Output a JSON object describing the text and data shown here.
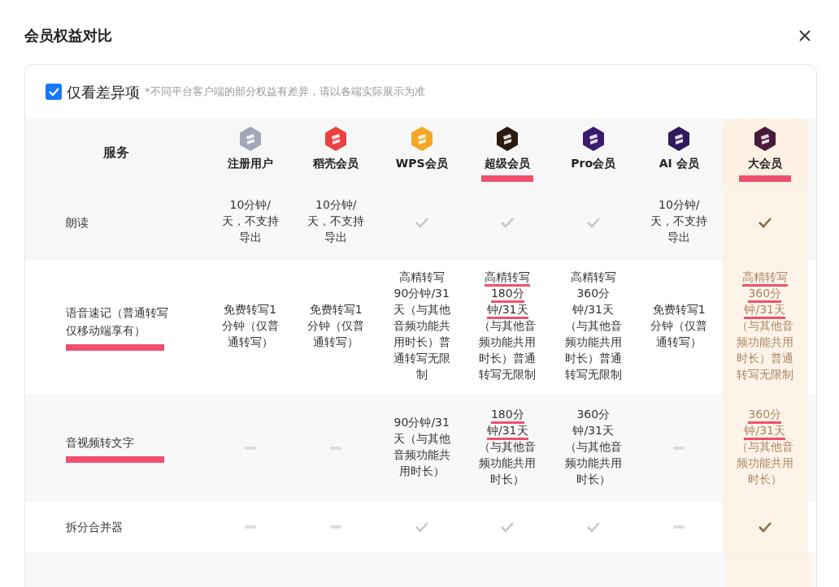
{
  "dialog": {
    "title": "会员权益对比"
  },
  "filter": {
    "label": "仅看差异项",
    "checked": true,
    "note": "*不同平台客户端的部分权益有差异，请以各端实际展示为准"
  },
  "table": {
    "service_heading": "服务",
    "columns": [
      {
        "label": "注册用户",
        "color": "#a3a7b8",
        "marked": false,
        "highlighted": false
      },
      {
        "label": "稻壳会员",
        "color": "#e8413f",
        "marked": false,
        "highlighted": false
      },
      {
        "label": "WPS会员",
        "color": "#f5a623",
        "marked": false,
        "highlighted": false
      },
      {
        "label": "超级会员",
        "color": "#2a1a10",
        "marked": true,
        "highlighted": false
      },
      {
        "label": "Pro会员",
        "color": "#3b1a6e",
        "marked": false,
        "highlighted": false
      },
      {
        "label": "AI 会员",
        "color": "#2e1a5c",
        "marked": false,
        "highlighted": false
      },
      {
        "label": "大会员",
        "color": "#4a1a3a",
        "marked": true,
        "highlighted": true
      }
    ],
    "rows": [
      {
        "label": "朗读",
        "marked": false,
        "cells": [
          {
            "kind": "text",
            "lines": [
              {
                "text": "10分钟/",
                "marked": false
              },
              {
                "text": "天，不支持",
                "marked": false
              },
              {
                "text": "导出",
                "marked": false
              }
            ]
          },
          {
            "kind": "text",
            "lines": [
              {
                "text": "10分钟/",
                "marked": false
              },
              {
                "text": "天，不支持",
                "marked": false
              },
              {
                "text": "导出",
                "marked": false
              }
            ]
          },
          {
            "kind": "check"
          },
          {
            "kind": "check"
          },
          {
            "kind": "check"
          },
          {
            "kind": "text",
            "lines": [
              {
                "text": "10分钟/",
                "marked": false
              },
              {
                "text": "天，不支持",
                "marked": false
              },
              {
                "text": "导出",
                "marked": false
              }
            ]
          },
          {
            "kind": "check"
          }
        ]
      },
      {
        "label": "语音速记（普通转写仅移动端享有）",
        "marked": true,
        "cells": [
          {
            "kind": "text",
            "lines": [
              {
                "text": "免费转写1",
                "marked": false
              },
              {
                "text": "分钟（仅普",
                "marked": false
              },
              {
                "text": "通转写）",
                "marked": false
              }
            ]
          },
          {
            "kind": "text",
            "lines": [
              {
                "text": "免费转写1",
                "marked": false
              },
              {
                "text": "分钟（仅普",
                "marked": false
              },
              {
                "text": "通转写）",
                "marked": false
              }
            ]
          },
          {
            "kind": "text",
            "lines": [
              {
                "text": "高精转写",
                "marked": false
              },
              {
                "text": "90分钟/31",
                "marked": false
              },
              {
                "text": "天（与其他",
                "marked": false
              },
              {
                "text": "音频功能共",
                "marked": false
              },
              {
                "text": "用时长）普",
                "marked": false
              },
              {
                "text": "通转写无限",
                "marked": false
              },
              {
                "text": "制",
                "marked": false
              }
            ]
          },
          {
            "kind": "text",
            "lines": [
              {
                "text": "高精转写",
                "marked": true
              },
              {
                "text": "180分",
                "marked": true
              },
              {
                "text": "钟/31天",
                "marked": true
              },
              {
                "text": "（与其他音",
                "marked": false
              },
              {
                "text": "频功能共用",
                "marked": false
              },
              {
                "text": "时长）普通",
                "marked": false
              },
              {
                "text": "转写无限制",
                "marked": false
              }
            ]
          },
          {
            "kind": "text",
            "lines": [
              {
                "text": "高精转写",
                "marked": false
              },
              {
                "text": "360分",
                "marked": false
              },
              {
                "text": "钟/31天",
                "marked": false
              },
              {
                "text": "（与其他音",
                "marked": false
              },
              {
                "text": "频功能共用",
                "marked": false
              },
              {
                "text": "时长）普通",
                "marked": false
              },
              {
                "text": "转写无限制",
                "marked": false
              }
            ]
          },
          {
            "kind": "text",
            "lines": [
              {
                "text": "免费转写1",
                "marked": false
              },
              {
                "text": "分钟（仅普",
                "marked": false
              },
              {
                "text": "通转写）",
                "marked": false
              }
            ]
          },
          {
            "kind": "text",
            "lines": [
              {
                "text": "高精转写",
                "marked": true
              },
              {
                "text": "360分",
                "marked": true
              },
              {
                "text": "钟/31天",
                "marked": true
              },
              {
                "text": "（与其他音",
                "marked": false
              },
              {
                "text": "频功能共用",
                "marked": false
              },
              {
                "text": "时长）普通",
                "marked": false
              },
              {
                "text": "转写无限制",
                "marked": false
              }
            ]
          }
        ]
      },
      {
        "label": "音视频转文字",
        "marked": true,
        "cells": [
          {
            "kind": "none"
          },
          {
            "kind": "none"
          },
          {
            "kind": "text",
            "lines": [
              {
                "text": "90分钟/31",
                "marked": false
              },
              {
                "text": "天（与其他",
                "marked": false
              },
              {
                "text": "音频功能共",
                "marked": false
              },
              {
                "text": "用时长）",
                "marked": false
              }
            ]
          },
          {
            "kind": "text",
            "lines": [
              {
                "text": "180分",
                "marked": true
              },
              {
                "text": "钟/31天",
                "marked": true
              },
              {
                "text": "（与其他音",
                "marked": false
              },
              {
                "text": "频功能共用",
                "marked": false
              },
              {
                "text": "时长）",
                "marked": false
              }
            ]
          },
          {
            "kind": "text",
            "lines": [
              {
                "text": "360分",
                "marked": false
              },
              {
                "text": "钟/31天",
                "marked": false
              },
              {
                "text": "（与其他音",
                "marked": false
              },
              {
                "text": "频功能共用",
                "marked": false
              },
              {
                "text": "时长）",
                "marked": false
              }
            ]
          },
          {
            "kind": "none"
          },
          {
            "kind": "text",
            "lines": [
              {
                "text": "360分",
                "marked": true
              },
              {
                "text": "钟/31天",
                "marked": true
              },
              {
                "text": "（与其他音",
                "marked": false
              },
              {
                "text": "频功能共用",
                "marked": false
              },
              {
                "text": "时长）",
                "marked": false
              }
            ]
          }
        ]
      },
      {
        "label": "拆分合并器",
        "marked": false,
        "cells": [
          {
            "kind": "none"
          },
          {
            "kind": "none"
          },
          {
            "kind": "check"
          },
          {
            "kind": "check"
          },
          {
            "kind": "check"
          },
          {
            "kind": "none"
          },
          {
            "kind": "check"
          }
        ]
      }
    ]
  }
}
